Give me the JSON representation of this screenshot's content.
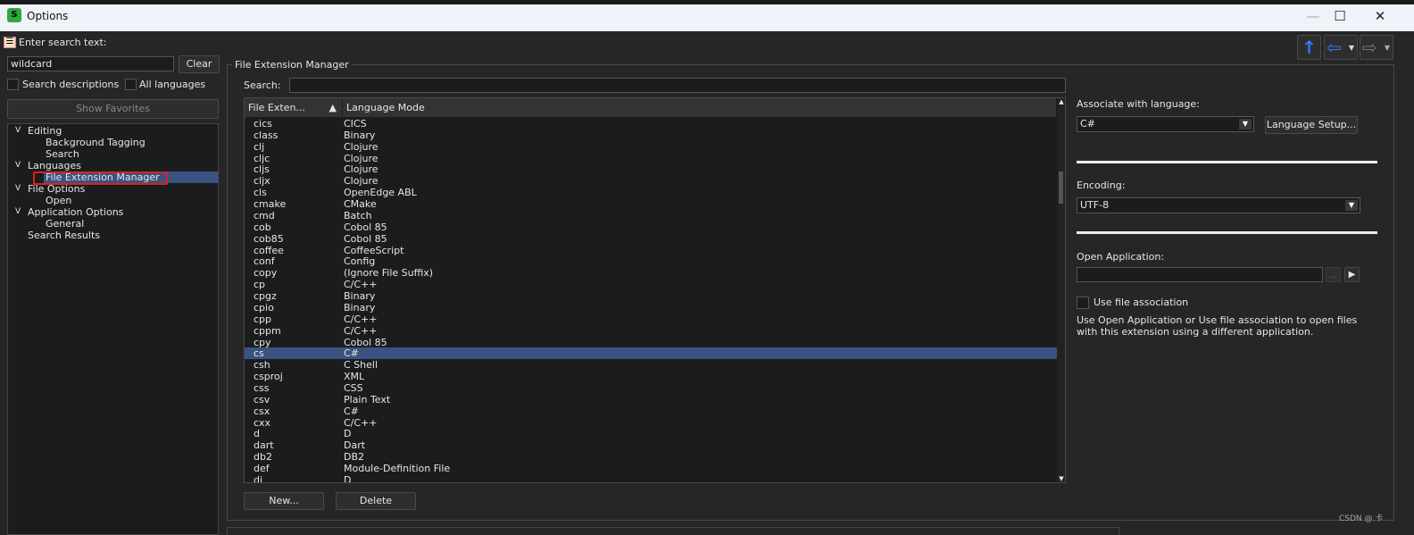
{
  "window": {
    "title": "Options",
    "app_icon": "slickedit-icon",
    "minimize": "—",
    "maximize": "☐",
    "close": "✕"
  },
  "left": {
    "search_label": "Enter search text:",
    "search_value": "wildcard",
    "clear": "Clear",
    "search_descriptions": "Search descriptions",
    "all_languages": "All languages",
    "show_favorites": "Show Favorites",
    "tree": [
      {
        "label": "Editing",
        "level": 0,
        "expanded": true
      },
      {
        "label": "Background Tagging",
        "level": 1
      },
      {
        "label": "Search",
        "level": 1
      },
      {
        "label": "Languages",
        "level": 0,
        "expanded": true
      },
      {
        "label": "File Extension Manager",
        "level": 1,
        "selected": true
      },
      {
        "label": "File Options",
        "level": 0,
        "expanded": true
      },
      {
        "label": "Open",
        "level": 1
      },
      {
        "label": "Application Options",
        "level": 0,
        "expanded": true
      },
      {
        "label": "General",
        "level": 1
      },
      {
        "label": "Search Results",
        "level": 0
      }
    ]
  },
  "nav": {
    "up": "up-arrow-icon",
    "back": "back-arrow-icon",
    "forward": "forward-arrow-icon"
  },
  "main": {
    "group_title": "File Extension Manager",
    "search_label": "Search:",
    "search_value": "",
    "columns": [
      "File Exten...",
      "Language Mode"
    ],
    "sort": "ascending",
    "rows": [
      [
        "cics",
        "CICS"
      ],
      [
        "class",
        "Binary"
      ],
      [
        "clj",
        "Clojure"
      ],
      [
        "cljc",
        "Clojure"
      ],
      [
        "cljs",
        "Clojure"
      ],
      [
        "cljx",
        "Clojure"
      ],
      [
        "cls",
        "OpenEdge ABL"
      ],
      [
        "cmake",
        "CMake"
      ],
      [
        "cmd",
        "Batch"
      ],
      [
        "cob",
        "Cobol 85"
      ],
      [
        "cob85",
        "Cobol 85"
      ],
      [
        "coffee",
        "CoffeeScript"
      ],
      [
        "conf",
        "Config"
      ],
      [
        "copy",
        "(Ignore File Suffix)"
      ],
      [
        "cp",
        "C/C++"
      ],
      [
        "cpgz",
        "Binary"
      ],
      [
        "cpio",
        "Binary"
      ],
      [
        "cpp",
        "C/C++"
      ],
      [
        "cppm",
        "C/C++"
      ],
      [
        "cpy",
        "Cobol 85"
      ],
      [
        "cs",
        "C#"
      ],
      [
        "csh",
        "C Shell"
      ],
      [
        "csproj",
        "XML"
      ],
      [
        "css",
        "CSS"
      ],
      [
        "csv",
        "Plain Text"
      ],
      [
        "csx",
        "C#"
      ],
      [
        "cxx",
        "C/C++"
      ],
      [
        "d",
        "D"
      ],
      [
        "dart",
        "Dart"
      ],
      [
        "db2",
        "DB2"
      ],
      [
        "def",
        "Module-Definition File"
      ],
      [
        "di",
        "D"
      ]
    ],
    "selected_row": "cs",
    "new": "New...",
    "delete": "Delete"
  },
  "right": {
    "associate_label": "Associate with language:",
    "associate_value": "C#",
    "language_setup": "Language Setup...",
    "encoding_label": "Encoding:",
    "encoding_value": "UTF-8",
    "open_app_label": "Open Application:",
    "open_app_value": "",
    "use_file_assoc": "Use file association",
    "help": "Use Open Application or Use file association to open files with this extension using a different application."
  },
  "watermark": "CSDN @.卡",
  "colors": {
    "selection": "#3a5280",
    "highlight_box": "#e0201c",
    "nav_blue": "#2f7bf5"
  }
}
